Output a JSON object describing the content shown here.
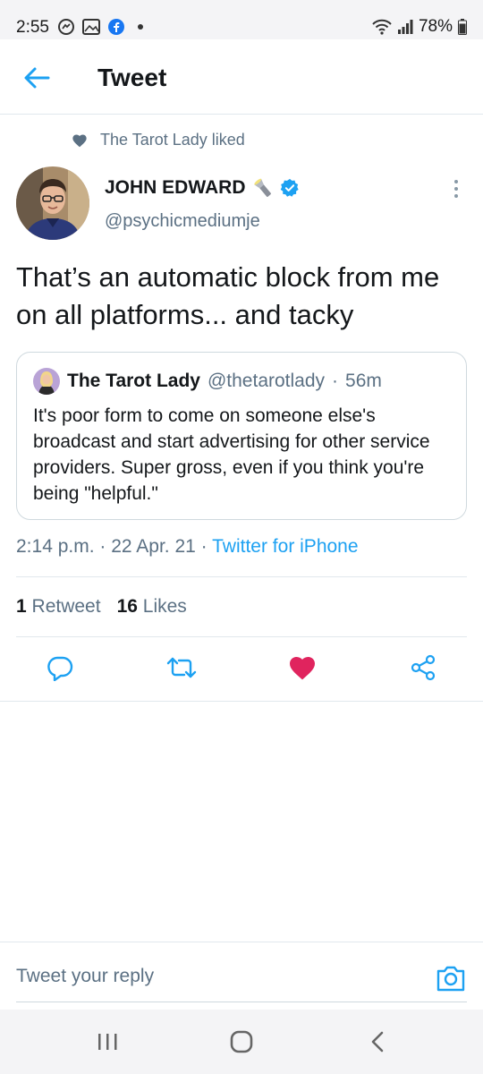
{
  "status_bar": {
    "time": "2:55",
    "battery": "78%"
  },
  "header": {
    "title": "Tweet"
  },
  "social_context": {
    "text": "The Tarot Lady liked"
  },
  "tweet": {
    "author_name": "JOHN EDWARD",
    "author_handle": "@psychicmediumje",
    "text": "That’s an automatic block from me on all platforms... and tacky",
    "timestamp": "2:14 p.m.",
    "date": "22 Apr. 21",
    "source": "Twitter for iPhone",
    "retweet_count": "1",
    "retweet_label": "Retweet",
    "like_count": "16",
    "like_label": "Likes",
    "liked": true
  },
  "quoted_tweet": {
    "author_name": "The Tarot Lady",
    "author_handle": "@thetarotlady",
    "age": "56m",
    "text": "It's poor form to come on someone else's broadcast and start advertising for other service providers. Super gross, even if you think you're being \"helpful.\""
  },
  "reply": {
    "placeholder": "Tweet your reply"
  },
  "colors": {
    "accent": "#1da1f2",
    "like": "#e0245e",
    "secondary_text": "#5b7083"
  },
  "icons": [
    "back-arrow-icon",
    "heart-icon",
    "flashlight-emoji-icon",
    "verified-badge-icon",
    "more-vertical-icon",
    "reply-icon",
    "retweet-icon",
    "like-icon",
    "share-icon",
    "camera-icon",
    "recent-apps-icon",
    "home-icon",
    "nav-back-icon"
  ]
}
